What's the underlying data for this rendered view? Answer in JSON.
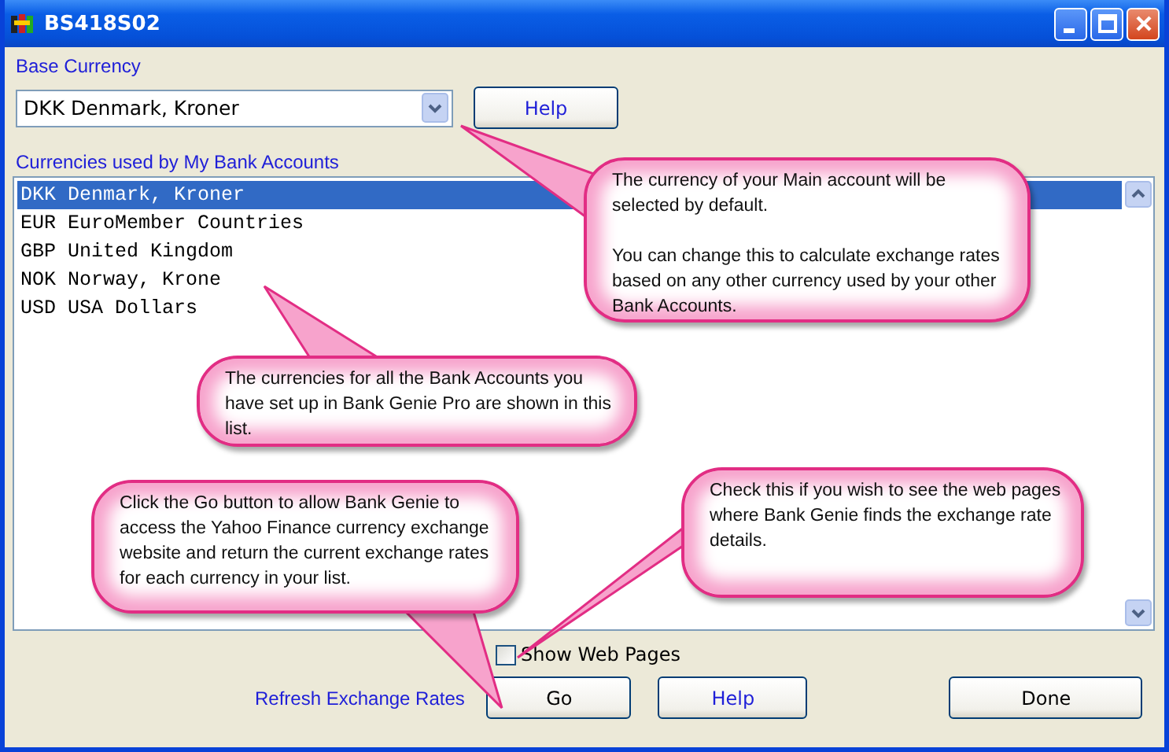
{
  "window": {
    "title": "BS418S02"
  },
  "base_currency": {
    "label": "Base Currency",
    "value": "DKK Denmark, Kroner"
  },
  "help_top": "Help",
  "accounts": {
    "label": "Currencies used by My Bank Accounts",
    "items": [
      {
        "text": "DKK Denmark, Kroner",
        "selected": true
      },
      {
        "text": "EUR EuroMember Countries",
        "selected": false
      },
      {
        "text": "GBP United Kingdom",
        "selected": false
      },
      {
        "text": "NOK Norway, Krone",
        "selected": false
      },
      {
        "text": "USD USA Dollars",
        "selected": false
      }
    ]
  },
  "show_web_pages": {
    "label": "Show Web Pages",
    "checked": false
  },
  "refresh_label": "Refresh Exchange Rates",
  "buttons": [
    {
      "label": "Go",
      "kind": "go"
    },
    {
      "label": "Help",
      "kind": "help"
    },
    {
      "label": "Done",
      "kind": "done"
    }
  ],
  "callouts": [
    {
      "paragraphs": [
        "The currency of your Main account will be selected by default.",
        "You can change this to calculate exchange rates based on any other currency used by your other Bank Accounts."
      ]
    },
    {
      "paragraphs": [
        "The currencies for all the Bank Accounts you have set up in Bank Genie Pro are shown in this list."
      ]
    },
    {
      "paragraphs": [
        "Click the Go button to allow Bank Genie to access the Yahoo Finance currency exchange website and return the current exchange rates for each currency in your list."
      ]
    },
    {
      "paragraphs": [
        "Check this if you wish to see the web pages where Bank Genie finds the exchange rate details."
      ]
    }
  ]
}
